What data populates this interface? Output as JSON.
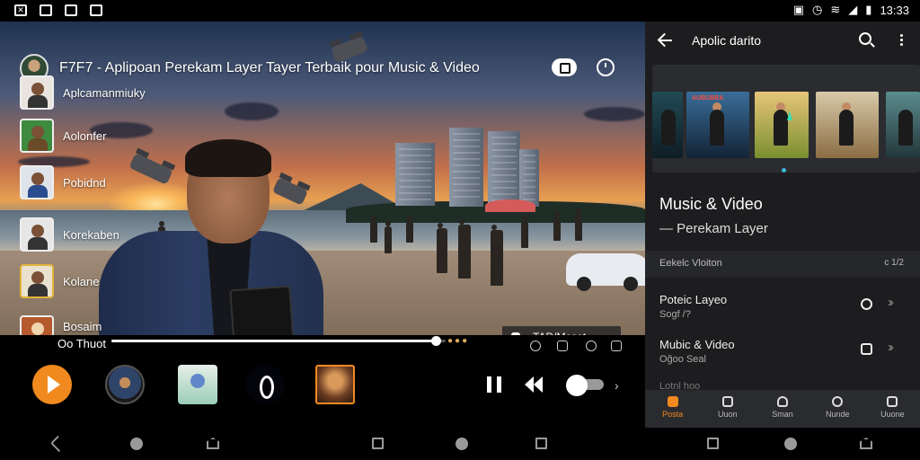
{
  "status_bar": {
    "left_icons": [
      "x-app-icon",
      "gallery-icon",
      "photo-icon",
      "image-icon"
    ],
    "time": "13:33"
  },
  "video": {
    "title": "F7F7 - Aplipoan Perekam Layer Tayer Terbaik pour Music & Video",
    "overlay_chip": "TAD/Meset",
    "current_time": "Oo Thuot",
    "progress": 0.97,
    "side_list": [
      {
        "label": "Aplcamanmiuky"
      },
      {
        "label": "Aolonfer"
      },
      {
        "label": "Pobidnd"
      },
      {
        "label": "Korekaben"
      },
      {
        "label": "Kolane"
      },
      {
        "label": "Bosaim"
      }
    ]
  },
  "player_controls": {
    "play_label": "play",
    "toggle_on": true
  },
  "panel": {
    "header_title": "Apolic darito",
    "section_title": "Music & Video",
    "section_subtitle": "— Perekam Layer",
    "meta_label": "Eekelc Vloiton",
    "meta_right": "c  1/2",
    "poster_caption": "AUBUBBA",
    "rows": [
      {
        "title": "Poteic Layeo",
        "sub": "Sogf /?"
      },
      {
        "title": "Mubic & Video",
        "sub": "Oğoo Seal"
      }
    ],
    "row_peek": "Lotnl hoo",
    "nav": [
      {
        "label": "Posta",
        "active": true
      },
      {
        "label": "Uuon",
        "active": false
      },
      {
        "label": "Sman",
        "active": false
      },
      {
        "label": "Nunde",
        "active": false
      },
      {
        "label": "Uuone",
        "active": false
      }
    ]
  },
  "colors": {
    "accent": "#f08a1f",
    "panel_bg": "#1d1d1f",
    "indicator": "#3fb6d9"
  }
}
